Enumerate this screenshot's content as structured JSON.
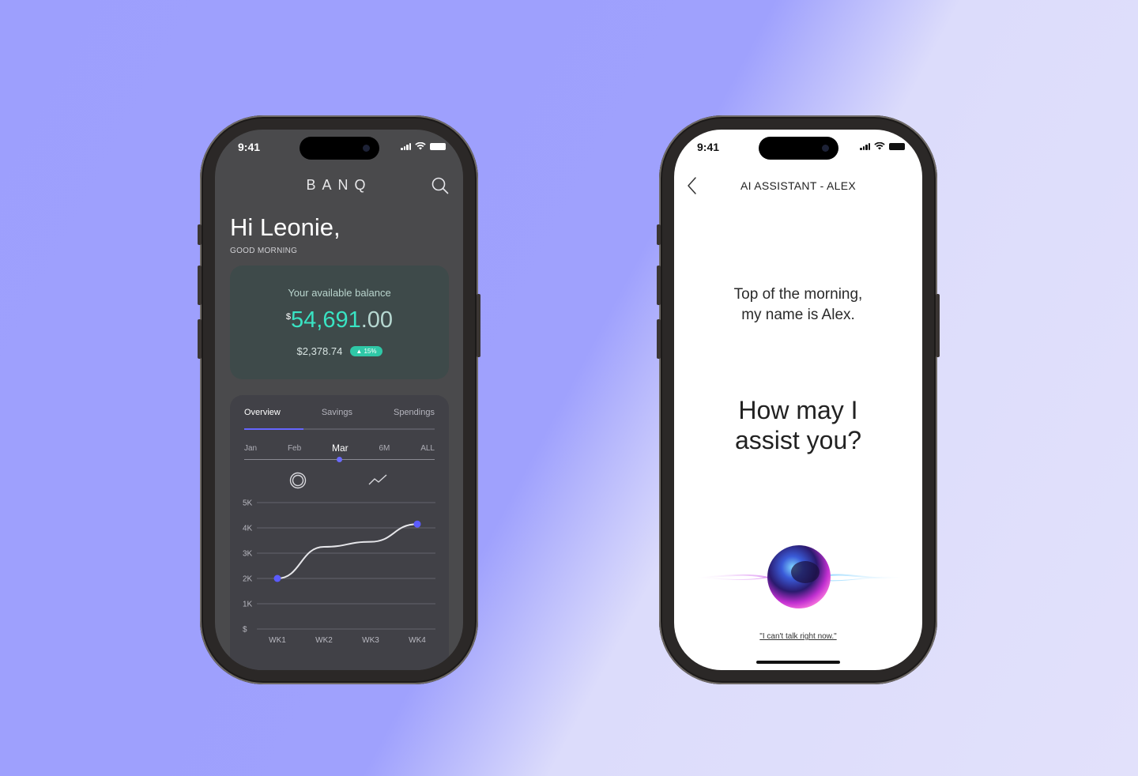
{
  "left_phone": {
    "status": {
      "time": "9:41"
    },
    "app": {
      "logo": "BANQ"
    },
    "greeting": {
      "title": "Hi Leonie,",
      "subtitle": "GOOD MORNING"
    },
    "balance": {
      "label": "Your available balance",
      "currency": "$",
      "whole": "54,691",
      "cents": ".00",
      "sub_amount": "$2,378.74",
      "change_badge": "▲ 15%"
    },
    "tabs": [
      {
        "label": "Overview",
        "active": true
      },
      {
        "label": "Savings",
        "active": false
      },
      {
        "label": "Spendings",
        "active": false
      }
    ],
    "periods": [
      {
        "label": "Jan"
      },
      {
        "label": "Feb"
      },
      {
        "label": "Mar",
        "active": true
      },
      {
        "label": "6M"
      },
      {
        "label": "ALL"
      }
    ],
    "chart_data": {
      "type": "line",
      "x": [
        "WK1",
        "WK2",
        "WK3",
        "WK4"
      ],
      "series": [
        {
          "values": [
            2000,
            3250,
            3450,
            4150
          ]
        }
      ],
      "y_ticks": [
        "$",
        "1K",
        "2K",
        "3K",
        "4K",
        "5K"
      ],
      "ylim": [
        0,
        5000
      ],
      "grid": true,
      "highlighted_points": [
        "WK1",
        "WK4"
      ],
      "colors": {
        "line": "#e6e6ea",
        "point": "#5b5bff",
        "grid": "#64646c"
      }
    }
  },
  "right_phone": {
    "status": {
      "time": "9:41"
    },
    "header": {
      "title": "AI ASSISTANT - ALEX"
    },
    "intro_line1": "Top of the morning,",
    "intro_line2": "my name is Alex.",
    "question_line1": "How may I",
    "question_line2": "assist you?",
    "decline_link": "\"I can't talk right now.\""
  },
  "colors": {
    "accent_teal": "#39e3c3",
    "accent_blue": "#6666ff",
    "dark_screen": "#4a4a4c"
  }
}
